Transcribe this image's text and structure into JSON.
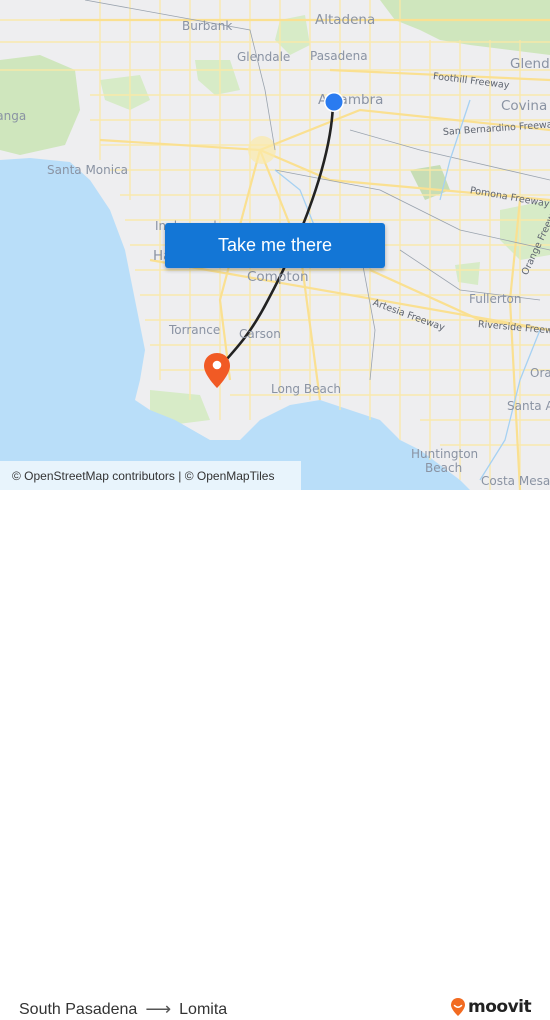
{
  "map": {
    "places": [
      {
        "name": "Altadena",
        "size": "big"
      },
      {
        "name": "Burbank",
        "size": "normal"
      },
      {
        "name": "Glendale",
        "size": "normal"
      },
      {
        "name": "Pasadena",
        "size": "normal"
      },
      {
        "name": "Alhambra",
        "size": "big"
      },
      {
        "name": "Glendora",
        "size": "big"
      },
      {
        "name": "Covina",
        "size": "big"
      },
      {
        "name": "Topanga",
        "size": "normal"
      },
      {
        "name": "Santa Monica",
        "size": "normal"
      },
      {
        "name": "Inglewood",
        "size": "normal"
      },
      {
        "name": "Hawthorne",
        "size": "big"
      },
      {
        "name": "Compton",
        "size": "big"
      },
      {
        "name": "Torrance",
        "size": "normal"
      },
      {
        "name": "Carson",
        "size": "normal"
      },
      {
        "name": "Long Beach",
        "size": "normal"
      },
      {
        "name": "Fullerton",
        "size": "normal"
      },
      {
        "name": "Orange",
        "size": "normal"
      },
      {
        "name": "Santa Ana",
        "size": "normal"
      },
      {
        "name": "Huntington",
        "size": "normal"
      },
      {
        "name": "Beach",
        "size": "normal"
      },
      {
        "name": "Costa Mesa",
        "size": "normal"
      }
    ],
    "highways": [
      "Foothill Freeway",
      "San Bernardino Freeway",
      "Pomona Freeway",
      "Orange Freeway",
      "Artesia Freeway",
      "Riverside Freeway"
    ],
    "origin_marker": {
      "label": "South Pasadena",
      "color": "#2a7bf0"
    },
    "destination_marker": {
      "label": "Lomita",
      "color": "#f15a24"
    },
    "route_line_color": "#222222"
  },
  "cta": {
    "label": "Take me there",
    "color": "#1376d6"
  },
  "attribution": "© OpenStreetMap contributors | © OpenMapTiles",
  "footer": {
    "origin": "South Pasadena",
    "arrow": "⟶",
    "destination": "Lomita",
    "brand": "moovit",
    "brand_color": "#f26b21"
  }
}
